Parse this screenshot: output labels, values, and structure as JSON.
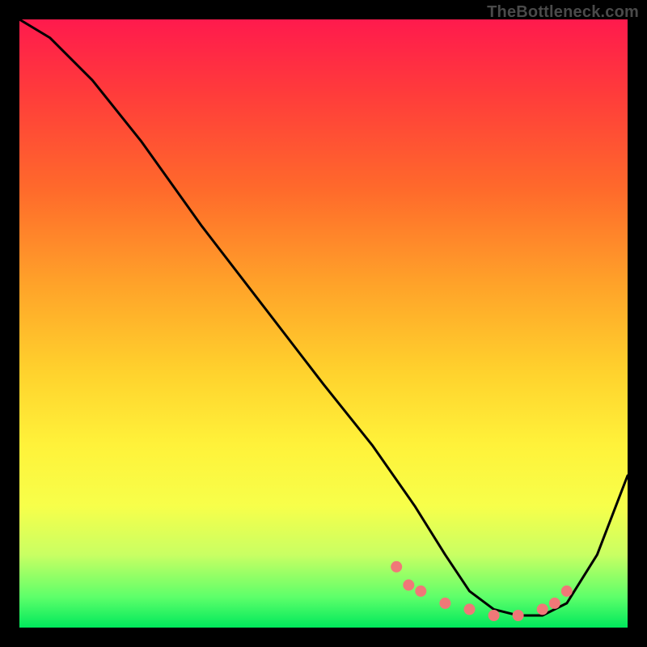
{
  "watermark": "TheBottleneck.com",
  "chart_data": {
    "type": "line",
    "title": "",
    "xlabel": "",
    "ylabel": "",
    "xlim": [
      0,
      100
    ],
    "ylim": [
      0,
      100
    ],
    "series": [
      {
        "name": "bottleneck-curve",
        "x": [
          0,
          5,
          12,
          20,
          30,
          40,
          50,
          58,
          65,
          70,
          74,
          78,
          82,
          86,
          90,
          95,
          100
        ],
        "values": [
          100,
          97,
          90,
          80,
          66,
          53,
          40,
          30,
          20,
          12,
          6,
          3,
          2,
          2,
          4,
          12,
          25
        ]
      }
    ],
    "markers": {
      "name": "highlight-dots",
      "color": "#f07878",
      "x": [
        62,
        64,
        66,
        70,
        74,
        78,
        82,
        86,
        88,
        90
      ],
      "values": [
        10,
        7,
        6,
        4,
        3,
        2,
        2,
        3,
        4,
        6
      ]
    }
  }
}
